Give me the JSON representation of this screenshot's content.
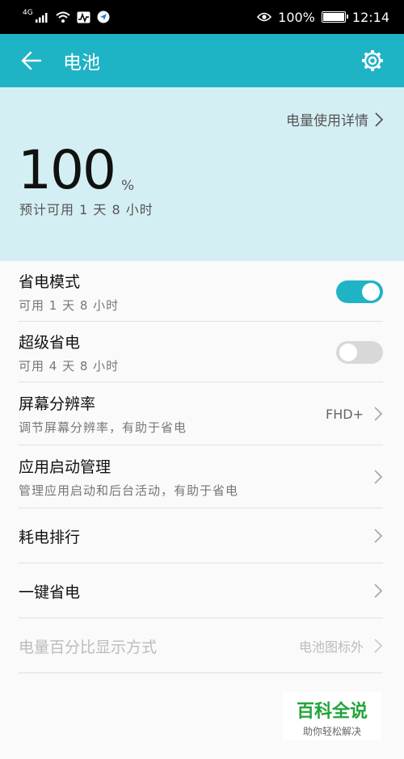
{
  "status_bar": {
    "network": "4G",
    "battery_text": "100%",
    "time": "12:14"
  },
  "app_bar": {
    "title": "电池"
  },
  "hero": {
    "details_link": "电量使用详情",
    "percent_value": "100",
    "percent_unit": "%",
    "estimate": "预计可用 1 天 8 小时"
  },
  "settings": [
    {
      "title": "省电模式",
      "subtitle": "可用 1 天 8 小时",
      "toggle": true
    },
    {
      "title": "超级省电",
      "subtitle": "可用 4 天 8 小时",
      "toggle": false
    },
    {
      "title": "屏幕分辨率",
      "subtitle": "调节屏幕分辨率，有助于省电",
      "value": "FHD+"
    },
    {
      "title": "应用启动管理",
      "subtitle": "管理应用启动和后台活动，有助于省电"
    },
    {
      "title": "耗电排行"
    },
    {
      "title": "一键省电"
    },
    {
      "title": "电量百分比显示方式",
      "value": "电池图标外",
      "disabled": true
    }
  ],
  "watermark": {
    "main": "百科全说",
    "sub": "助你轻松解决"
  },
  "colors": {
    "accent": "#1fb3c6",
    "hero_bg": "#d4eff3",
    "toggle_off": "#d8d8d8"
  },
  "icons": [
    "signal-icon",
    "wifi-icon",
    "activity-icon",
    "navigation-icon",
    "eye-icon",
    "battery-icon",
    "back-arrow-icon",
    "gear-icon",
    "chevron-right-icon"
  ]
}
